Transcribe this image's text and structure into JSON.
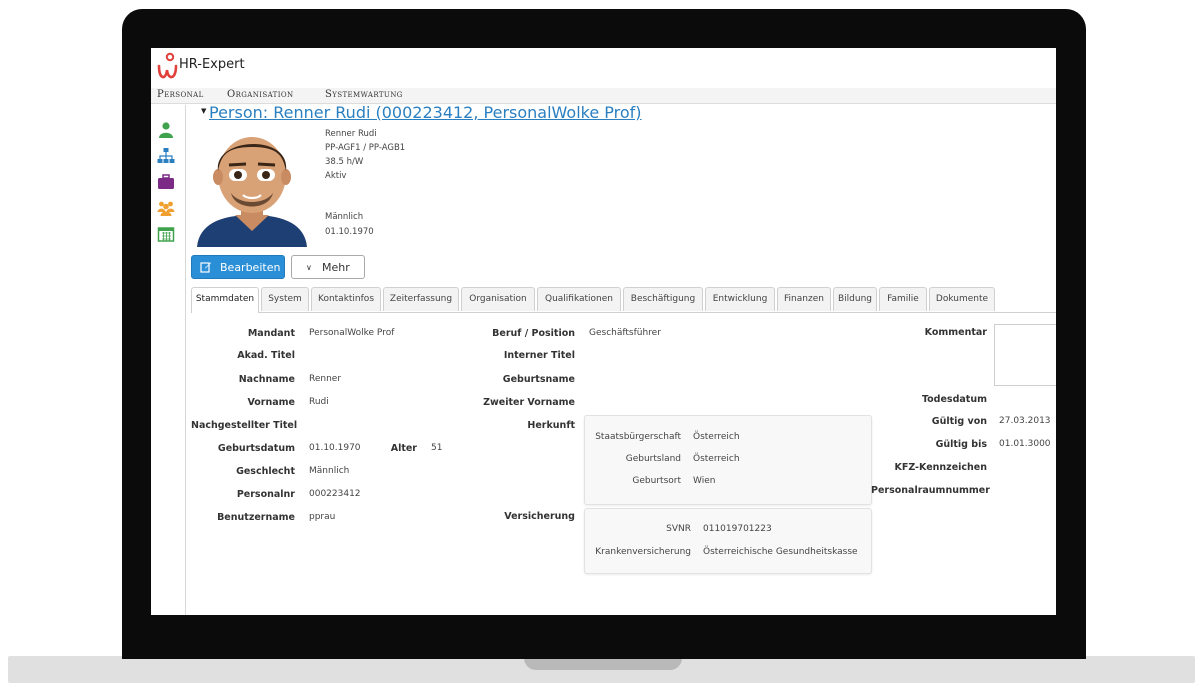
{
  "app": {
    "title": "HR-Expert"
  },
  "menu": [
    "Personal",
    "Organisation",
    "Systemwartung"
  ],
  "sidebar_icons": [
    "person-icon",
    "org-chart-icon",
    "briefcase-icon",
    "group-icon",
    "calendar-icon"
  ],
  "person": {
    "heading": "Person: Renner Rudi (000223412, PersonalWolke Prof)",
    "summary": [
      "Renner Rudi",
      "PP-AGF1 / PP-AGB1",
      "38.5 h/W",
      "Aktiv",
      "Männlich",
      "01.10.1970"
    ]
  },
  "actions": {
    "edit_label": "Bearbeiten",
    "more_label": "Mehr"
  },
  "tabs": [
    "Stammdaten",
    "System",
    "Kontaktinfos",
    "Zeiterfassung",
    "Organisation",
    "Qualifikationen",
    "Beschäftigung",
    "Entwicklung",
    "Finanzen",
    "Bildung",
    "Familie",
    "Dokumente"
  ],
  "left_fields": [
    {
      "label": "Mandant",
      "value": "PersonalWolke Prof"
    },
    {
      "label": "Akad. Titel",
      "value": ""
    },
    {
      "label": "Nachname",
      "value": "Renner"
    },
    {
      "label": "Vorname",
      "value": "Rudi"
    },
    {
      "label": "Nachgestellter Titel",
      "value": ""
    },
    {
      "label": "Geburtsdatum",
      "value": "01.10.1970"
    },
    {
      "label": "Geschlecht",
      "value": "Männlich"
    },
    {
      "label": "Personalnr",
      "value": "000223412"
    },
    {
      "label": "Benutzername",
      "value": "pprau"
    }
  ],
  "age": {
    "label": "Alter",
    "value": "51"
  },
  "middle_fields": [
    {
      "label": "Beruf / Position",
      "value": "Geschäftsführer"
    },
    {
      "label": "Interner Titel",
      "value": ""
    },
    {
      "label": "Geburtsname",
      "value": ""
    },
    {
      "label": "Zweiter Vorname",
      "value": ""
    }
  ],
  "herkunft": {
    "label": "Herkunft",
    "rows": [
      {
        "label": "Staatsbürgerschaft",
        "value": "Österreich"
      },
      {
        "label": "Geburtsland",
        "value": "Österreich"
      },
      {
        "label": "Geburtsort",
        "value": "Wien"
      }
    ]
  },
  "versicherung": {
    "label": "Versicherung",
    "rows": [
      {
        "label": "SVNR",
        "value": "011019701223"
      },
      {
        "label": "Krankenversicherung",
        "value": "Österreichische Gesundheitskasse"
      }
    ]
  },
  "right_fields": [
    {
      "label": "Kommentar",
      "value": ""
    },
    {
      "label": "Todesdatum",
      "value": ""
    },
    {
      "label": "Gültig von",
      "value": "27.03.2013"
    },
    {
      "label": "Gültig bis",
      "value": "01.01.3000"
    },
    {
      "label": "KFZ-Kennzeichen",
      "value": ""
    },
    {
      "label": "Personalraumnummer",
      "value": ""
    }
  ],
  "colors": {
    "accent": "#2a8fd6",
    "link": "#2a7fc0",
    "logo_red": "#e0413a"
  }
}
